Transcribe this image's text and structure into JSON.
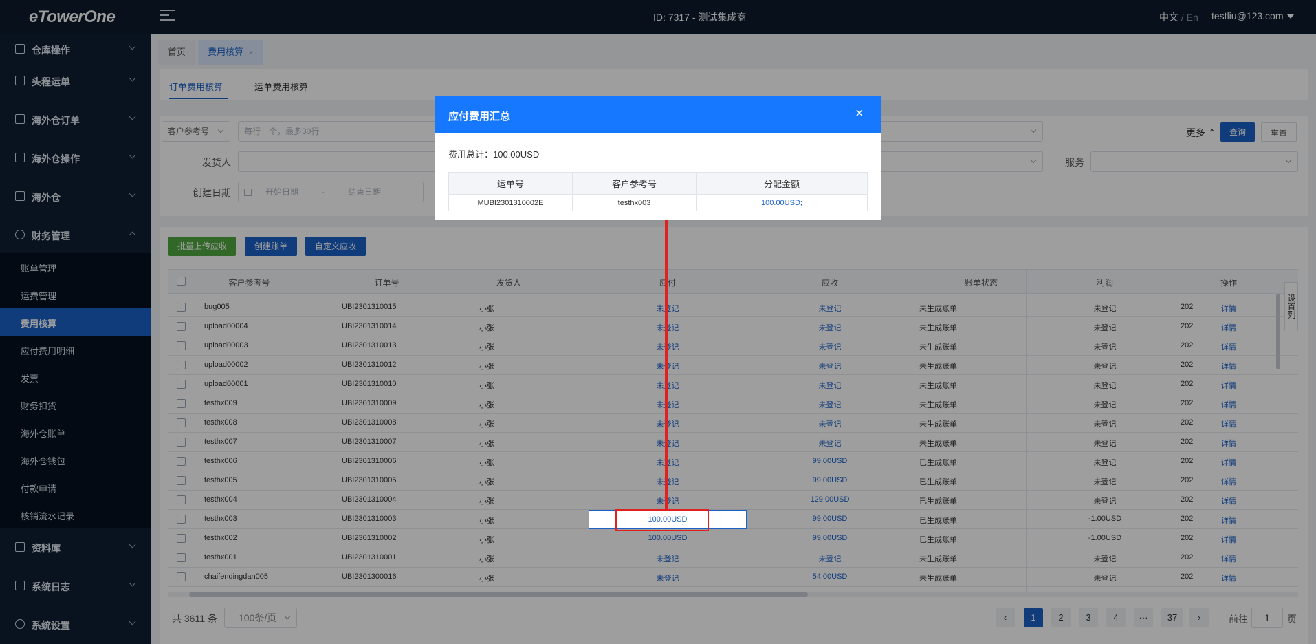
{
  "topbar": {
    "logo": "eTowerOne",
    "center_text": "ID: 7317 - 测试集成商",
    "lang_current": "中文",
    "lang_sep": " / ",
    "lang_other": "En",
    "user": "testliu@123.com"
  },
  "sidebar": {
    "groups": [
      {
        "label": "仓库操作",
        "icon": "warehouse-icon"
      },
      {
        "label": "头程运单",
        "icon": "lock-icon"
      },
      {
        "label": "海外仓订单",
        "icon": "order-icon"
      },
      {
        "label": "海外仓操作",
        "icon": "home-icon"
      },
      {
        "label": "海外仓",
        "icon": "warehouse-icon"
      },
      {
        "label": "财务管理",
        "icon": "currency-icon"
      },
      {
        "label": "资料库",
        "icon": "database-icon"
      },
      {
        "label": "系统日志",
        "icon": "log-icon"
      },
      {
        "label": "系统设置",
        "icon": "gear-icon"
      }
    ],
    "finance_items": [
      "账单管理",
      "运费管理",
      "费用核算",
      "应付费用明细",
      "发票",
      "财务扣货",
      "海外仓账单",
      "海外仓钱包",
      "付款申请",
      "核销流水记录"
    ]
  },
  "tabs": {
    "home": "首页",
    "current": "费用核算",
    "close": "×"
  },
  "subtabs": {
    "order": "订单费用核算",
    "waybill": "运单费用核算"
  },
  "filters": {
    "ref_type": "客户参考号",
    "ref_placeholder": "每行一个，最多30行",
    "shipper_label": "发货人",
    "date_label": "创建日期",
    "date_start": "开始日期",
    "date_sep": "-",
    "date_end": "结束日期",
    "service_label": "服务",
    "more": "更多",
    "query": "查询",
    "reset": "重置"
  },
  "actions": {
    "batch_upload": "批量上传应收",
    "create_bill": "创建账单",
    "custom_receivable": "自定义应收"
  },
  "table": {
    "headers": [
      "客户参考号",
      "订单号",
      "发货人",
      "应付",
      "应收",
      "账单状态",
      "利润",
      "操作"
    ],
    "rows": [
      [
        "bug005",
        "UBI2301310015",
        "小张",
        "未登记",
        "未登记",
        "未生成账单",
        "未登记",
        "202",
        "详情"
      ],
      [
        "upload00004",
        "UBI2301310014",
        "小张",
        "未登记",
        "未登记",
        "未生成账单",
        "未登记",
        "202",
        "详情"
      ],
      [
        "upload00003",
        "UBI2301310013",
        "小张",
        "未登记",
        "未登记",
        "未生成账单",
        "未登记",
        "202",
        "详情"
      ],
      [
        "upload00002",
        "UBI2301310012",
        "小张",
        "未登记",
        "未登记",
        "未生成账单",
        "未登记",
        "202",
        "详情"
      ],
      [
        "upload00001",
        "UBI2301310010",
        "小张",
        "未登记",
        "未登记",
        "未生成账单",
        "未登记",
        "202",
        "详情"
      ],
      [
        "testhx009",
        "UBI2301310009",
        "小张",
        "未登记",
        "未登记",
        "未生成账单",
        "未登记",
        "202",
        "详情"
      ],
      [
        "testhx008",
        "UBI2301310008",
        "小张",
        "未登记",
        "未登记",
        "未生成账单",
        "未登记",
        "202",
        "详情"
      ],
      [
        "testhx007",
        "UBI2301310007",
        "小张",
        "未登记",
        "未登记",
        "未生成账单",
        "未登记",
        "202",
        "详情"
      ],
      [
        "testhx006",
        "UBI2301310006",
        "小张",
        "未登记",
        "99.00USD",
        "已生成账单",
        "未登记",
        "202",
        "详情"
      ],
      [
        "testhx005",
        "UBI2301310005",
        "小张",
        "未登记",
        "99.00USD",
        "已生成账单",
        "未登记",
        "202",
        "详情"
      ],
      [
        "testhx004",
        "UBI2301310004",
        "小张",
        "未登记",
        "129.00USD",
        "已生成账单",
        "未登记",
        "202",
        "详情"
      ],
      [
        "testhx003",
        "UBI2301310003",
        "小张",
        "100.00USD",
        "99.00USD",
        "已生成账单",
        "-1.00USD",
        "202",
        "详情"
      ],
      [
        "testhx002",
        "UBI2301310002",
        "小张",
        "100.00USD",
        "99.00USD",
        "已生成账单",
        "-1.00USD",
        "202",
        "详情"
      ],
      [
        "testhx001",
        "UBI2301310001",
        "小张",
        "未登记",
        "未登记",
        "未生成账单",
        "未登记",
        "202",
        "详情"
      ],
      [
        "chaifendingdan005",
        "UBI2301300016",
        "小张",
        "未登记",
        "54.00USD",
        "未生成账单",
        "未登记",
        "202",
        "详情"
      ]
    ],
    "settings_tab": "设置列"
  },
  "pagination": {
    "total": "共 3611 条",
    "page_size": "100条/页",
    "prev": "‹",
    "next": "›",
    "pages": [
      "1",
      "2",
      "3",
      "4",
      "···",
      "37"
    ],
    "goto_prefix": "前往",
    "goto_value": "1",
    "goto_suffix": "页"
  },
  "modal": {
    "title": "应付费用汇总",
    "close": "×",
    "total": "费用总计：100.00USD",
    "headers": [
      "运单号",
      "客户参考号",
      "分配金额"
    ],
    "row": [
      "MUBI2301310002E",
      "testhx003",
      "100.00USD;"
    ]
  },
  "colors": {
    "primary": "#1b61c8",
    "modal_header": "#1677ff",
    "annotation": "#e32020",
    "sidebar": "#0f1f33"
  }
}
